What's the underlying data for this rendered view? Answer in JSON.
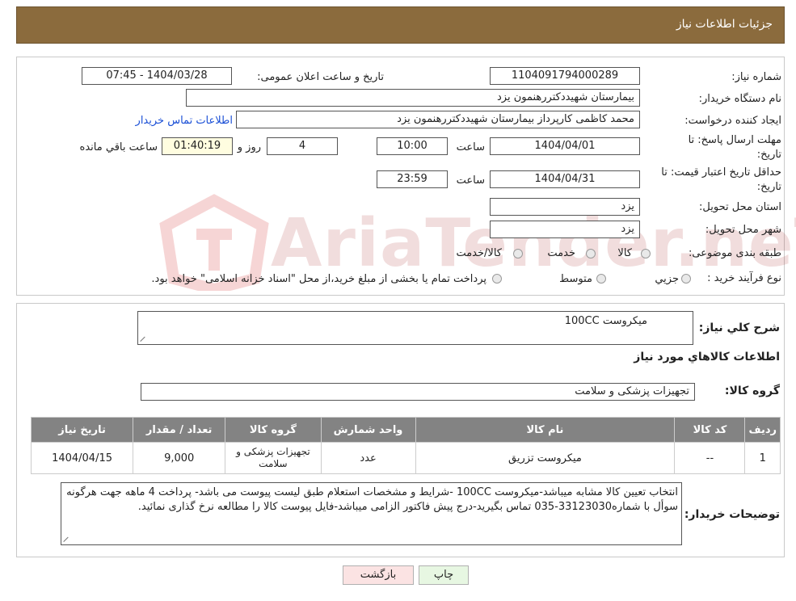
{
  "header": {
    "title": "جزئیات اطلاعات نیاز"
  },
  "colors": {
    "header_bg": "#8b6b3d",
    "header_text": "#ffffff",
    "table_header": "#838383"
  },
  "watermark": {
    "text": "AriaTender.neT"
  },
  "form": {
    "need_number_label": "شماره نیاز:",
    "need_number": "1104091794000289",
    "announce_label": "تاریخ و ساعت اعلان عمومی:",
    "announce_value": "1404/03/28 - 07:45",
    "buyer_org_label": "نام دستگاه خریدار:",
    "buyer_org": "بیمارستان شهیددکتررهنمون یزد",
    "creator_label": "ایجاد کننده درخواست:",
    "creator": "محمد کاظمی کارپرداز بیمارستان شهیددکتررهنمون یزد",
    "contact_link": "اطلاعات تماس خریدار",
    "deadline_label_1": "مهلت ارسال پاسخ: تا",
    "deadline_label_2": "تاریخ:",
    "deadline_date": "1404/04/01",
    "time_label": "ساعت",
    "deadline_time": "10:00",
    "days_value": "4",
    "days_label": "روز و",
    "remaining_time": "01:40:19",
    "remaining_label": "ساعت باقي مانده",
    "validity_label_1": "حداقل تاریخ اعتبار قیمت: تا",
    "validity_label_2": "تاریخ:",
    "validity_date": "1404/04/31",
    "validity_time": "23:59",
    "province_label": "استان محل تحویل:",
    "province": "یزد",
    "city_label": "شهر محل تحویل:",
    "city": "یزد",
    "category_label": "طبقه بندی موضوعی:",
    "category_options": [
      "کالا",
      "خدمت",
      "کالا/خدمت"
    ],
    "process_label": "نوع فرآیند خرید :",
    "process_options": [
      "جزیي",
      "متوسط"
    ],
    "process_note": "پرداخت تمام یا بخشی از مبلغ خرید،از محل \"اسناد خزانه اسلامی\" خواهد بود."
  },
  "need": {
    "summary_label": "شرح کلي نیاز:",
    "summary_value": "میکروست 100CC",
    "goods_info_title": "اطلاعات کالاهاي مورد نیاز",
    "goods_group_label": "گروه کالا:",
    "goods_group_value": "تجهیزات پزشکی و سلامت"
  },
  "table": {
    "headers": [
      "ردیف",
      "کد کالا",
      "نام کالا",
      "واحد شمارش",
      "گروه کالا",
      "تعداد / مقدار",
      "تاریخ نیاز"
    ],
    "rows": [
      [
        "1",
        "--",
        "میکروست تزریق",
        "عدد",
        "تجهیزات پزشکی و سلامت",
        "9,000",
        "1404/04/15"
      ]
    ]
  },
  "notes": {
    "label": "توضیحات خریدار:",
    "text": "انتخاب تعیین کالا مشابه میباشد-میکروست 100CC -شرایط و مشخصات استعلام طبق لیست پیوست می باشد- پرداخت 4 ماهه جهت هرگونه سوأل با شماره33123030-035 تماس بگیرید-درج پیش فاکتور الزامی میباشد-فایل پیوست کالا را مطالعه نرخ گذاری نمائید."
  },
  "buttons": {
    "print": "چاپ",
    "back": "بازگشت"
  }
}
